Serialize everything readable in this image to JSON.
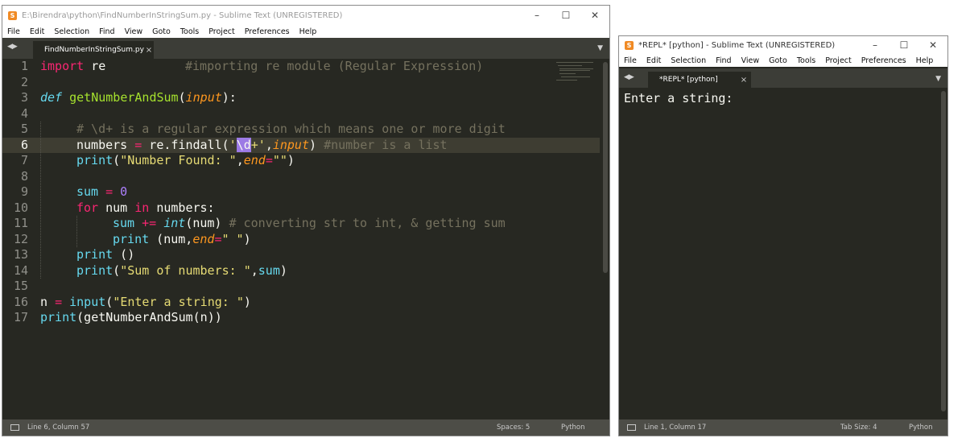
{
  "editor_window": {
    "title": "E:\\Birendra\\python\\FindNumberInStringSum.py - Sublime Text (UNREGISTERED)",
    "menu": [
      "File",
      "Edit",
      "Selection",
      "Find",
      "View",
      "Goto",
      "Tools",
      "Project",
      "Preferences",
      "Help"
    ],
    "tab": {
      "label": "FindNumberInStringSum.py",
      "close": "×"
    },
    "line_numbers": [
      "1",
      "2",
      "3",
      "4",
      "5",
      "6",
      "7",
      "8",
      "9",
      "10",
      "11",
      "12",
      "13",
      "14",
      "15",
      "16",
      "17"
    ],
    "active_line": "6",
    "code": {
      "l1_import": "import",
      "l1_module": " re",
      "l1_comment": "#importing re module (Regular Expression)",
      "l3_def": "def",
      "l3_name": "getNumberAndSum",
      "l3_open": "(",
      "l3_param": "input",
      "l3_close": "):",
      "l5_comment": "# \\d+ is a regular expression which means one or more digit",
      "l6_var": "numbers ",
      "l6_eq": "=",
      "l6_call": " re.findall(",
      "l6_q1": "'",
      "l6_sel": "\\d",
      "l6_plus": "+'",
      "l6_arg": ",",
      "l6_input": "input",
      "l6_close": ") ",
      "l6_comment": "#number is a list",
      "l7_print": "print",
      "l7_open": "(",
      "l7_str": "\"Number Found: \"",
      "l7_comma": ",",
      "l7_kw": "end",
      "l7_eq": "=",
      "l7_str2": "\"\"",
      "l7_close": ")",
      "l9_var": "sum ",
      "l9_eq": "=",
      "l9_num": " 0",
      "l10_for": "for",
      "l10_var": " num ",
      "l10_in": "in",
      "l10_rest": " numbers:",
      "l11_var": "sum ",
      "l11_op": "+=",
      "l11_int": " int",
      "l11_args": "(num) ",
      "l11_comment": "# converting str to int, & getting sum",
      "l12_print": "print",
      "l12_open": " (num,",
      "l12_kw": "end",
      "l12_eq": "=",
      "l12_str": "\" \"",
      "l12_close": ")",
      "l13_print": "print",
      "l13_rest": " ()",
      "l14_print": "print",
      "l14_open": "(",
      "l14_str": "\"Sum of numbers: \"",
      "l14_rest": ",",
      "l14_sum": "sum",
      "l14_close": ")",
      "l16_var": "n ",
      "l16_eq": "=",
      "l16_input": " input",
      "l16_open": "(",
      "l16_str": "\"Enter a string: \"",
      "l16_close": ")",
      "l17_print": "print",
      "l17_rest": "(getNumberAndSum(n))"
    },
    "status": {
      "position": "Line 6, Column 57",
      "indent": "Spaces: 5",
      "syntax": "Python"
    }
  },
  "repl_window": {
    "title": "*REPL* [python] - Sublime Text (UNREGISTERED)",
    "menu": [
      "File",
      "Edit",
      "Selection",
      "Find",
      "View",
      "Goto",
      "Tools",
      "Project",
      "Preferences",
      "Help"
    ],
    "tab": {
      "label": "*REPL* [python]",
      "close": "×"
    },
    "output": "Enter a string:",
    "status": {
      "position": "Line 1, Column 17",
      "indent": "Tab Size: 4",
      "syntax": "Python"
    }
  },
  "colors": {
    "background": "#272822",
    "keyword": "#f92672",
    "function": "#a6e22e",
    "string": "#e6db74",
    "comment": "#75715e",
    "number": "#ae81ff",
    "selection": "#9c7ae5"
  },
  "icons": {
    "app": "sublime-text-icon",
    "minimize": "minimize-icon",
    "maximize": "maximize-icon",
    "close": "close-icon"
  }
}
